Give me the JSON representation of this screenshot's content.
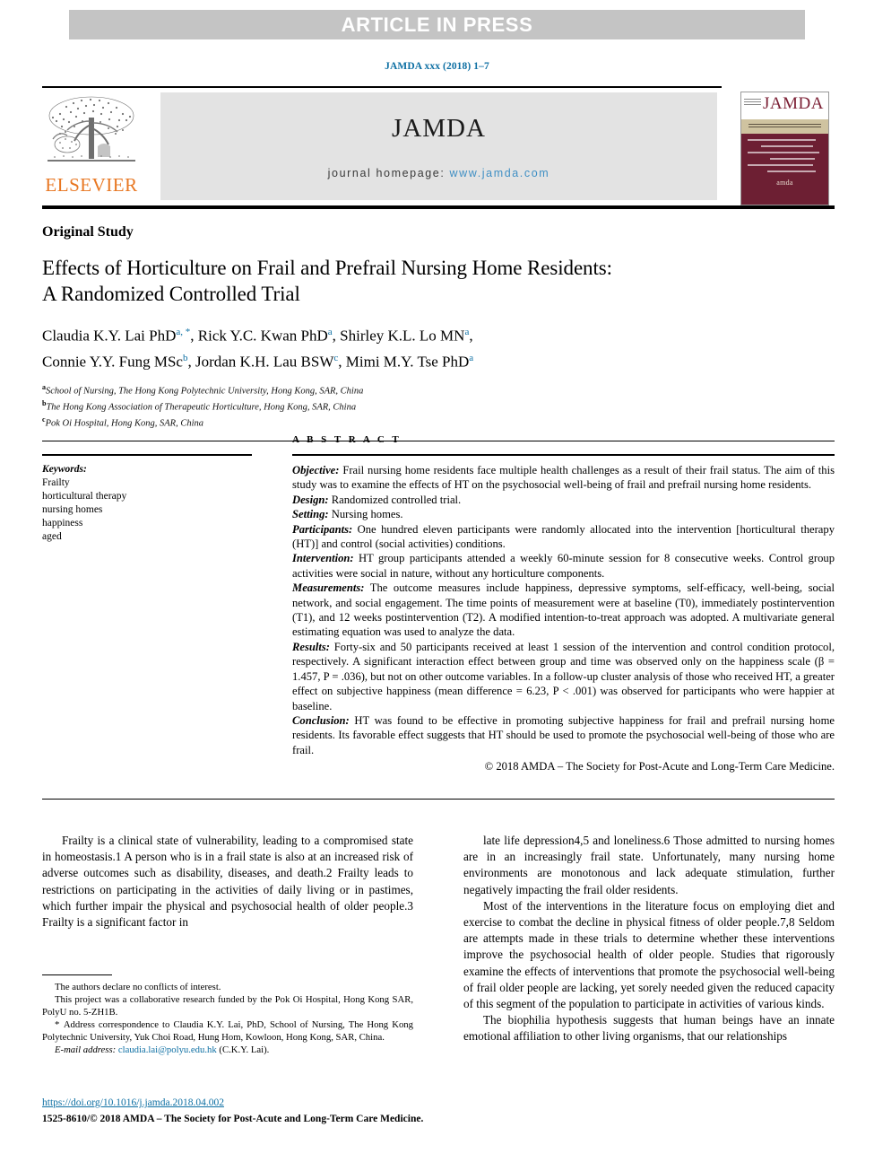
{
  "banner": {
    "text": "ARTICLE IN PRESS"
  },
  "journal_ref": "JAMDA xxx (2018) 1–7",
  "masthead": {
    "publisher_name": "ELSEVIER",
    "publisher_logo_alt": "elsevier-tree-logo",
    "journal_title": "JAMDA",
    "homepage_label": "journal homepage:",
    "homepage_url": "www.jamda.com",
    "cover": {
      "title": "JAMDA",
      "footer_mark": "amda"
    }
  },
  "article": {
    "study_type": "Original Study",
    "title_line1": "Effects of Horticulture on Frail and Prefrail Nursing Home Residents:",
    "title_line2": "A Randomized Controlled Trial",
    "authors_line1": "Claudia K.Y. Lai PhD",
    "authors": [
      {
        "name": "Claudia K.Y. Lai PhD",
        "marks": "a, *"
      },
      {
        "name": "Rick Y.C. Kwan PhD",
        "marks": "a"
      },
      {
        "name": "Shirley K.L. Lo MN",
        "marks": "a"
      },
      {
        "name": "Connie Y.Y. Fung MSc",
        "marks": "b"
      },
      {
        "name": "Jordan K.H. Lau BSW",
        "marks": "c"
      },
      {
        "name": "Mimi M.Y. Tse PhD",
        "marks": "a"
      }
    ],
    "affiliations": [
      {
        "marker": "a",
        "text": "School of Nursing, The Hong Kong Polytechnic University, Hong Kong, SAR, China"
      },
      {
        "marker": "b",
        "text": "The Hong Kong Association of Therapeutic Horticulture, Hong Kong, SAR, China"
      },
      {
        "marker": "c",
        "text": "Pok Oi Hospital, Hong Kong, SAR, China"
      }
    ]
  },
  "keywords": {
    "heading": "Keywords:",
    "items": [
      "Frailty",
      "horticultural therapy",
      "nursing homes",
      "happiness",
      "aged"
    ]
  },
  "abstract": {
    "label": "A B S T R A C T",
    "sections": [
      {
        "name": "Objective:",
        "text": " Frail nursing home residents face multiple health challenges as a result of their frail status. The aim of this study was to examine the effects of HT on the psychosocial well-being of frail and prefrail nursing home residents."
      },
      {
        "name": "Design:",
        "text": " Randomized controlled trial."
      },
      {
        "name": "Setting:",
        "text": " Nursing homes."
      },
      {
        "name": "Participants:",
        "text": " One hundred eleven participants were randomly allocated into the intervention [horticultural therapy (HT)] and control (social activities) conditions."
      },
      {
        "name": "Intervention:",
        "text": " HT group participants attended a weekly 60-minute session for 8 consecutive weeks. Control group activities were social in nature, without any horticulture components."
      },
      {
        "name": "Measurements:",
        "text": " The outcome measures include happiness, depressive symptoms, self-efficacy, well-being, social network, and social engagement. The time points of measurement were at baseline (T0), immediately postintervention (T1), and 12 weeks postintervention (T2). A modified intention-to-treat approach was adopted. A multivariate general estimating equation was used to analyze the data."
      },
      {
        "name": "Results:",
        "text": " Forty-six and 50 participants received at least 1 session of the intervention and control condition protocol, respectively. A significant interaction effect between group and time was observed only on the happiness scale (β = 1.457, P = .036), but not on other outcome variables. In a follow-up cluster analysis of those who received HT, a greater effect on subjective happiness (mean difference = 6.23, P < .001) was observed for participants who were happier at baseline."
      },
      {
        "name": "Conclusion:",
        "text": " HT was found to be effective in promoting subjective happiness for frail and prefrail nursing home residents. Its favorable effect suggests that HT should be used to promote the psychosocial well-being of those who are frail."
      }
    ],
    "copyright": "© 2018 AMDA – The Society for Post-Acute and Long-Term Care Medicine."
  },
  "body": {
    "left_col": [
      "Frailty is a clinical state of vulnerability, leading to a compromised state in homeostasis.1 A person who is in a frail state is also at an increased risk of adverse outcomes such as disability, diseases, and death.2 Frailty leads to restrictions on participating in the activities of daily living or in pastimes, which further impair the physical and psychosocial health of older people.3 Frailty is a significant factor in"
    ],
    "right_col": [
      "late life depression4,5 and loneliness.6 Those admitted to nursing homes are in an increasingly frail state. Unfortunately, many nursing home environments are monotonous and lack adequate stimulation, further negatively impacting the frail older residents.",
      "Most of the interventions in the literature focus on employing diet and exercise to combat the decline in physical fitness of older people.7,8 Seldom are attempts made in these trials to determine whether these interventions improve the psychosocial health of older people. Studies that rigorously examine the effects of interventions that promote the psychosocial well-being of frail older people are lacking, yet sorely needed given the reduced capacity of this segment of the population to participate in activities of various kinds.",
      "The biophilia hypothesis suggests that human beings have an innate emotional affiliation to other living organisms, that our relationships"
    ]
  },
  "footnotes": {
    "conflict": "The authors declare no conflicts of interest.",
    "funding": "This project was a collaborative research funded by the Pok Oi Hospital, Hong Kong SAR, PolyU no. 5-ZH1B.",
    "correspondence_marker": "*",
    "correspondence": "Address correspondence to Claudia K.Y. Lai, PhD, School of Nursing, The Hong Kong Polytechnic University, Yuk Choi Road, Hung Hom, Kowloon, Hong Kong, SAR, China.",
    "email_label": "E-mail address:",
    "email": "claudia.lai@polyu.edu.hk",
    "email_owner": "(C.K.Y. Lai)."
  },
  "footer": {
    "doi": "https://doi.org/10.1016/j.jamda.2018.04.002",
    "issn_line": "1525-8610/© 2018 AMDA – The Society for Post-Acute and Long-Term Care Medicine."
  },
  "colors": {
    "link_blue": "#0d6fa3",
    "banner_gray": "#c4c4c4",
    "elsevier_orange": "#e87722",
    "cover_maroon": "#6d1f33",
    "cover_band": "#cfc3a0"
  }
}
